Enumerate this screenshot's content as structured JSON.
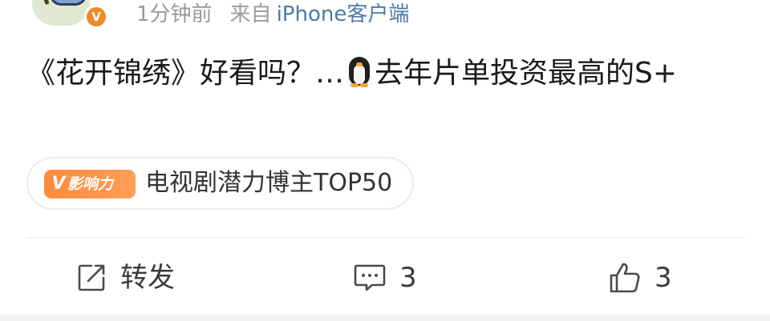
{
  "header": {
    "verified_badge": "V",
    "time": "1分钟前",
    "from_label": "来自",
    "client": "iPhone客户端"
  },
  "post": {
    "text_before_emoji": "《花开锦绣》好看吗？…",
    "emoji": "penguin-emoji",
    "text_after_emoji": "去年片单投资最高的S+"
  },
  "tag": {
    "chip_v": "V",
    "chip_text": "影响力",
    "label": "电视剧潜力博主TOP50"
  },
  "actions": {
    "repost_label": "转发",
    "comment_count": "3",
    "like_count": "3"
  },
  "colors": {
    "meta_gray": "#9a9a9a",
    "client_blue": "#4d79a8",
    "badge_orange": "#f08a24",
    "chip_orange": "#ff8a3d",
    "text": "#1a1a1a"
  }
}
